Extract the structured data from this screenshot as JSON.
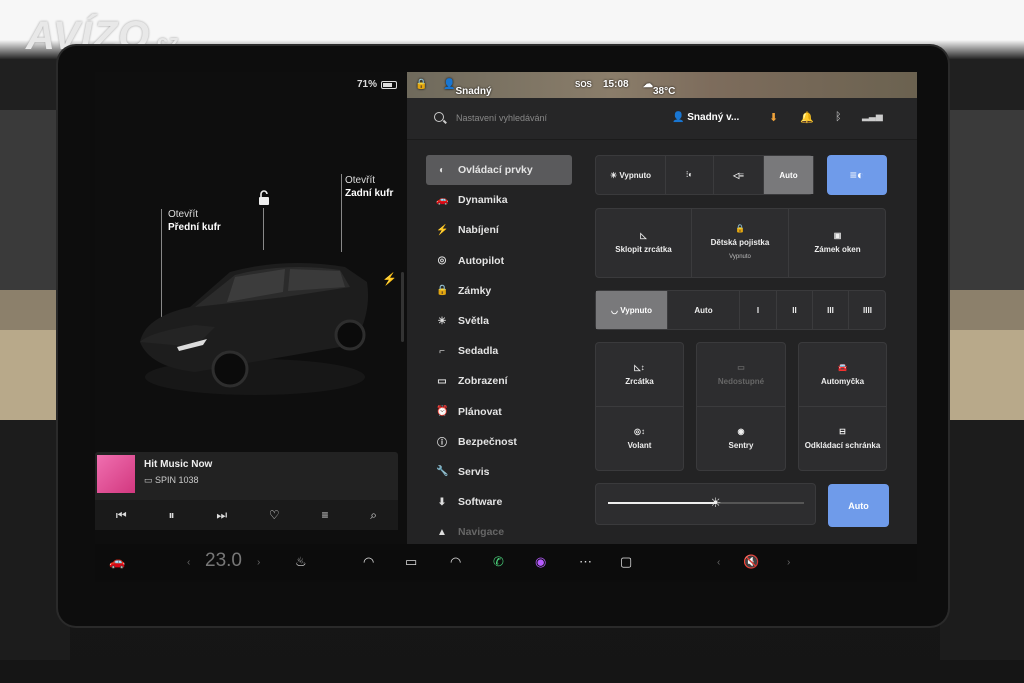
{
  "watermark": {
    "brand": "AVÍZO",
    "tld": ".cz"
  },
  "status": {
    "battery": "71%"
  },
  "car_view": {
    "frunk_action": "Otevřít",
    "frunk_name": "Přední kufr",
    "trunk_action": "Otevřít",
    "trunk_name": "Zadní kufr"
  },
  "media": {
    "track": "Hit Music Now",
    "station": "SPIN 1038",
    "controls": [
      "prev-icon",
      "pause-icon",
      "next-icon",
      "heart-icon",
      "equalizer-icon",
      "search-icon"
    ]
  },
  "topbar": {
    "profile": "Snadný vstup",
    "sos": "SOS",
    "time": "15:08",
    "temperature": "38°C"
  },
  "search": {
    "placeholder": "Nastavení vyhledávání",
    "profile": "Snadný v..."
  },
  "menu": [
    {
      "label": "Ovládací prvky",
      "icon": "toggle-icon",
      "active": true
    },
    {
      "label": "Dynamika",
      "icon": "car-icon"
    },
    {
      "label": "Nabíjení",
      "icon": "bolt-icon"
    },
    {
      "label": "Autopilot",
      "icon": "steering-wheel-icon"
    },
    {
      "label": "Zámky",
      "icon": "lock-icon"
    },
    {
      "label": "Světla",
      "icon": "sun-icon"
    },
    {
      "label": "Sedadla",
      "icon": "seat-icon"
    },
    {
      "label": "Zobrazení",
      "icon": "display-icon"
    },
    {
      "label": "Plánovat",
      "icon": "alarm-icon"
    },
    {
      "label": "Bezpečnost",
      "icon": "info-icon"
    },
    {
      "label": "Servis",
      "icon": "wrench-icon"
    },
    {
      "label": "Software",
      "icon": "download-icon"
    },
    {
      "label": "Navigace",
      "icon": "navigation-icon"
    }
  ],
  "lights": {
    "off": "Vypnuto",
    "auto": "Auto",
    "selected": "Auto"
  },
  "quick": {
    "mirrors": "Sklopit zrcátka",
    "child_lock": "Dětská pojistka",
    "child_lock_state": "Vypnuto",
    "window_lock": "Zámek oken"
  },
  "wipers": {
    "off": "Vypnuto",
    "auto": "Auto",
    "levels": [
      "I",
      "II",
      "III",
      "IIII"
    ],
    "selected": "Vypnuto"
  },
  "tiles": {
    "mirrors": "Zrcátka",
    "unavailable": "Nedostupné",
    "car_wash": "Automyčka",
    "wheel": "Volant",
    "sentry": "Sentry",
    "glovebox": "Odkládací schránka"
  },
  "brightness": {
    "auto": "Auto",
    "level": 0.55
  },
  "dock": {
    "temperature": "23.0"
  }
}
